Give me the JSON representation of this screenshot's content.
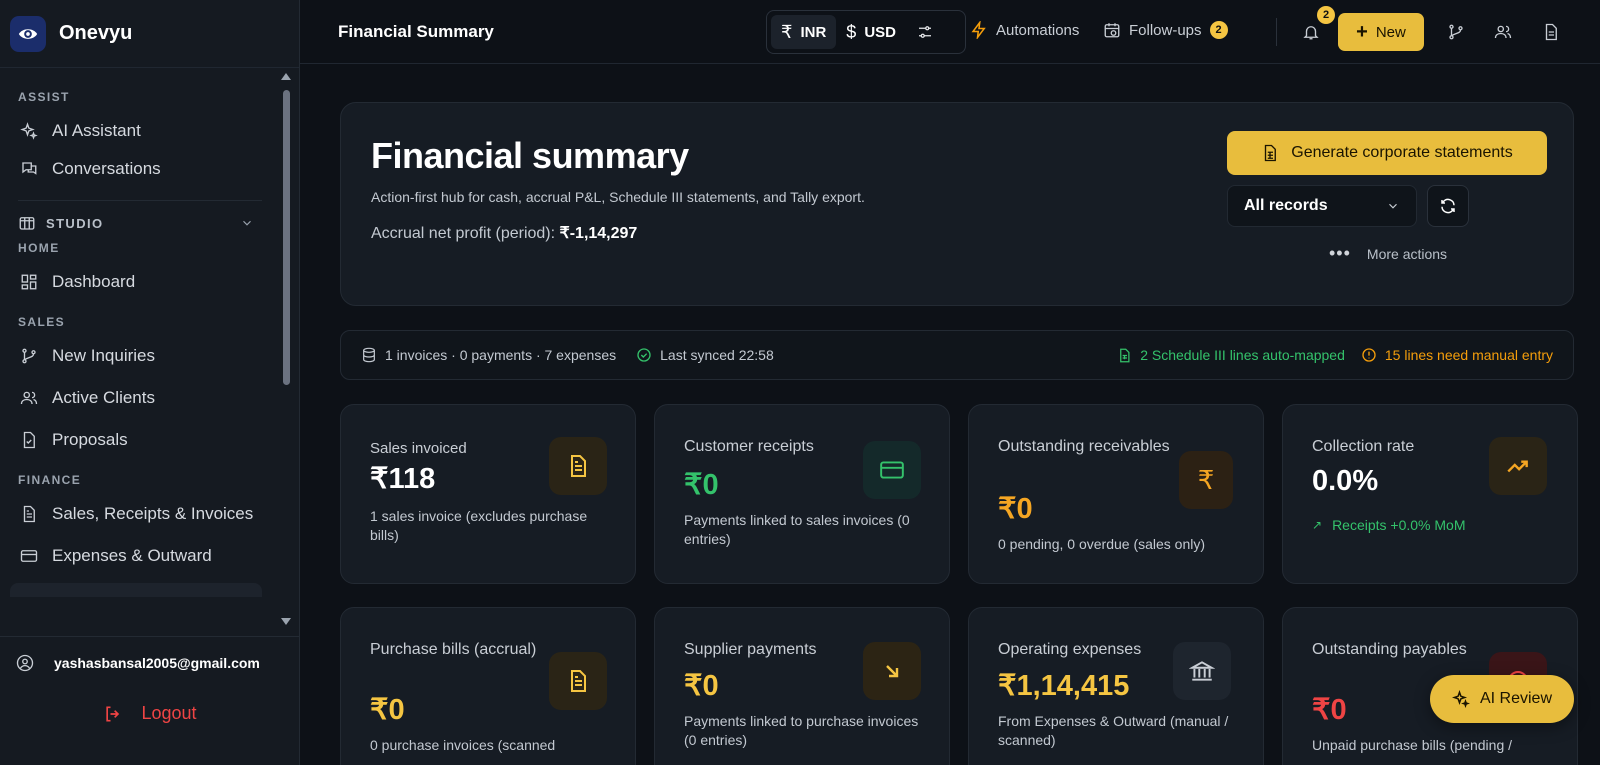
{
  "brand": {
    "name": "Onevyu"
  },
  "sidebar": {
    "assist_label": "ASSIST",
    "assist_items": [
      {
        "label": "AI Assistant"
      },
      {
        "label": "Conversations"
      }
    ],
    "studio_label": "STUDIO",
    "home_label": "HOME",
    "home_items": [
      {
        "label": "Dashboard"
      }
    ],
    "sales_label": "SALES",
    "sales_items": [
      {
        "label": "New Inquiries"
      },
      {
        "label": "Active Clients"
      },
      {
        "label": "Proposals"
      }
    ],
    "finance_label": "FINANCE",
    "finance_items": [
      {
        "label": "Sales, Receipts & Invoices"
      },
      {
        "label": "Expenses & Outward"
      }
    ],
    "user_email": "yashasbansal2005@gmail.com",
    "logout_label": "Logout"
  },
  "header": {
    "title": "Financial Summary",
    "currency_inr": "INR",
    "currency_usd": "USD",
    "currency_inr_symbol": "₹",
    "currency_usd_symbol": "$",
    "automations": "Automations",
    "followups": "Follow-ups",
    "followups_count": "2",
    "notifications_count": "2",
    "new_label": "New"
  },
  "hero": {
    "title": "Financial summary",
    "subtitle": "Action-first hub for cash, accrual P&L, Schedule III statements, and Tally export.",
    "profit_label": "Accrual net profit (period):",
    "profit_value": "₹-1,14,297",
    "generate_label": "Generate corporate statements",
    "filter_value": "All records",
    "more_actions": "More actions"
  },
  "status": {
    "counts": "1 invoices · 0 payments · 7 expenses",
    "synced": "Last synced 22:58",
    "mapped": "2 Schedule III lines auto-mapped",
    "manual": "15 lines need manual entry"
  },
  "cards": [
    {
      "title": "Sales invoiced",
      "value": "₹118",
      "desc": "1 sales invoice (excludes purchase bills)",
      "value_color": "#ffffff",
      "icon": "document-icon"
    },
    {
      "title": "Customer receipts",
      "value": "₹0",
      "desc": "Payments linked to sales invoices (0 entries)",
      "value_color": "#34c26b",
      "icon": "card-icon"
    },
    {
      "title": "Outstanding receivables",
      "value": "₹0",
      "desc": "0 pending, 0 overdue (sales only)",
      "value_color": "#f5a623",
      "icon": "rupee-icon"
    },
    {
      "title": "Collection rate",
      "value": "0.0%",
      "trend": "Receipts +0.0% MoM",
      "value_color": "#ffffff",
      "icon": "trend-up-icon"
    },
    {
      "title": "Purchase bills (accrual)",
      "value": "₹0",
      "desc": "0 purchase invoices (scanned",
      "value_color": "#f5c542",
      "icon": "document-icon"
    },
    {
      "title": "Supplier payments",
      "value": "₹0",
      "desc": "Payments linked to purchase invoices (0 entries)",
      "value_color": "#f5c542",
      "icon": "arrow-down-right-icon"
    },
    {
      "title": "Operating expenses",
      "value": "₹1,14,415",
      "desc": "From Expenses & Outward (manual / scanned)",
      "value_color": "#f5c542",
      "icon": "bank-icon"
    },
    {
      "title": "Outstanding payables",
      "value": "₹0",
      "desc": "Unpaid purchase bills (pending /",
      "value_color": "#ef4444",
      "icon": "alert-icon"
    }
  ],
  "ai_review": "AI Review",
  "colors": {
    "accent": "#e8bd3d",
    "success": "#34c26b",
    "warning": "#f59e0b",
    "danger": "#ef4444",
    "background": "#0d1117"
  }
}
